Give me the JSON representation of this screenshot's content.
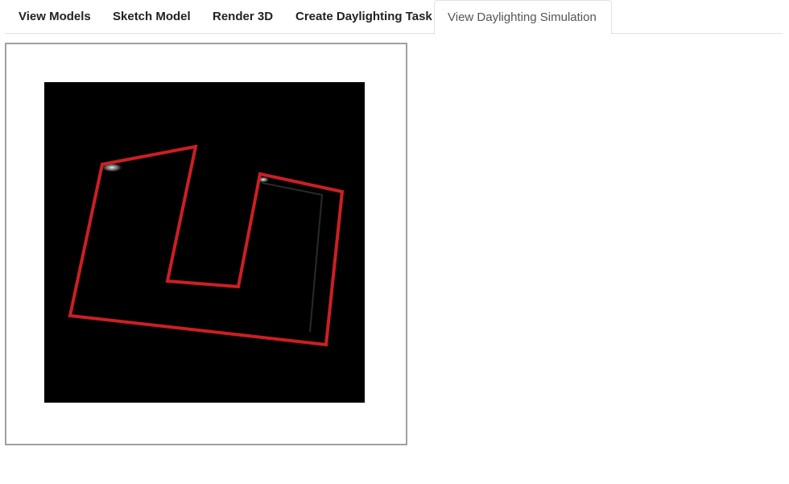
{
  "tabs": [
    {
      "label": "View Models",
      "active": false
    },
    {
      "label": "Sketch Model",
      "active": false
    },
    {
      "label": "Render 3D",
      "active": false
    },
    {
      "label": "Create Daylighting Task",
      "active": false
    },
    {
      "label": "View Daylighting Simulation",
      "active": true
    }
  ],
  "simulation": {
    "background_color": "#000000",
    "outline_color": "#cc1f24"
  }
}
